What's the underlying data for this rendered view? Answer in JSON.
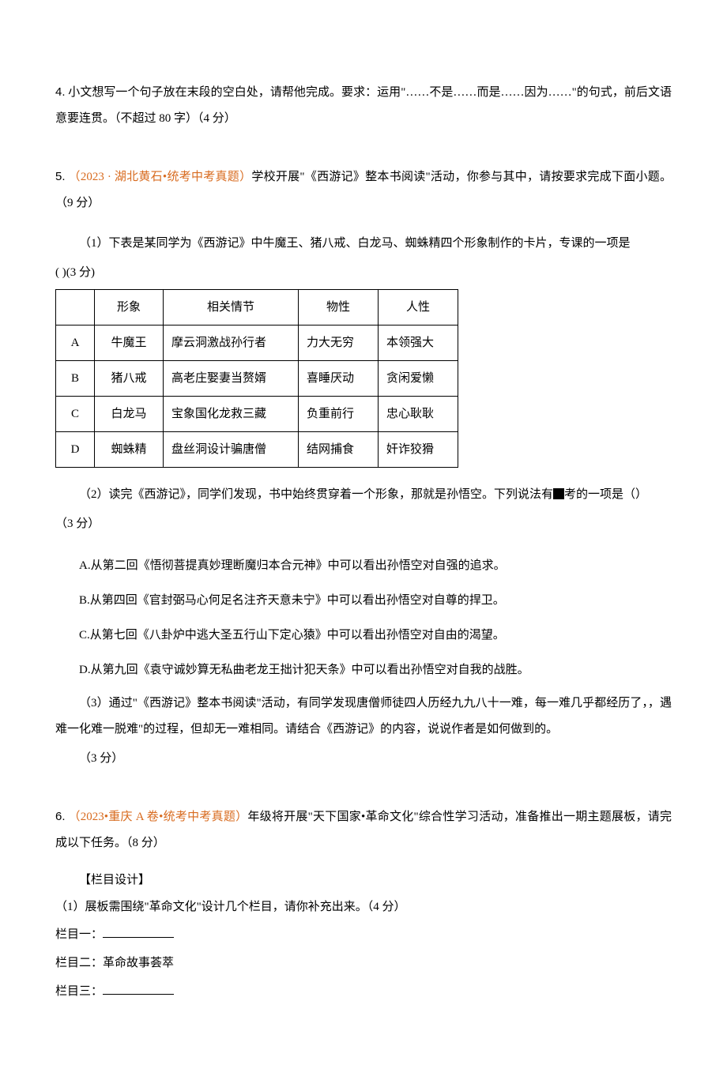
{
  "q4": {
    "number": "4.",
    "text": "  小文想写一个句子放在末段的空白处，请帮他完成。要求：运用\"……不是……而是……因为……\"的句式，前后文语意要连贯。（不超过 80 字）（4 分）"
  },
  "q5": {
    "number": "5.",
    "source": "（2023 · 湖北黄石•统考中考真题）",
    "intro": "学校开展\"《西游记》整本书阅读\"活动，你参与其中，请按要求完成下面小题。（9 分）",
    "sub1_a": "（1）下表是某同学为《西游记》中牛魔王、猪八戒、白龙马、蜘蛛精四个形象制作的卡片，专课的一项是",
    "sub1_b": "(        )(3 分)",
    "table": {
      "headers": [
        "",
        "形象",
        "相关情节",
        "物性",
        "人性"
      ],
      "rows": [
        [
          "A",
          "牛魔王",
          "摩云洞激战孙行者",
          "力大无穷",
          "本领强大"
        ],
        [
          "B",
          "猪八戒",
          "高老庄娶妻当赘婿",
          "喜睡厌动",
          "贪闲爱懒"
        ],
        [
          "C",
          "白龙马",
          "宝象国化龙救三藏",
          "负重前行",
          "忠心耿耿"
        ],
        [
          "D",
          "蜘蛛精",
          "盘丝洞设计骗唐僧",
          "结网捕食",
          "奸诈狡猾"
        ]
      ]
    },
    "sub2_a": "（2）读完《西游记》，同学们发现，书中始终贯穿着一个形象，那就是孙悟空。下列说法有",
    "sub2_b": "考的一项是（）",
    "sub2_points": "（3 分）",
    "options2": [
      "A.从第二回《悟彻菩提真妙理断魔归本合元神》中可以看出孙悟空对自强的追求。",
      "B.从第四回《官封弼马心何足名注齐天意未宁》中可以看出孙悟空对自尊的捍卫。",
      "C.从第七回《八卦炉中逃大圣五行山下定心猿》中可以看出孙悟空对自由的渴望。",
      "D.从第九回《袁守诚妙算无私曲老龙王拙计犯天条》中可以看出孙悟空对自我的战胜。"
    ],
    "sub3_a": "（3）通过\"《西游记》整本书阅读\"活动，有同学发现唐僧师徒四人历经九九八十一难，每一难几乎都经历了，，遇难一化难一脱难\"的过程，但却无一难相同。请结合《西游记》的内容，说说作者是如何做到的。",
    "sub3_points": "（3 分）"
  },
  "q6": {
    "number": "6.",
    "source": "（2023•重庆 A 卷•统考中考真题）",
    "intro": "年级将开展\"天下国家•革命文化\"综合性学习活动，准备推出一期主题展板，请完成以下任务。（8 分）",
    "heading": "【栏目设计】",
    "sub1": "（1）展板需围绕\"革命文化\"设计几个栏目，请你补充出来。（4 分）",
    "col1_label": "栏目一：",
    "col2_label": "栏目二：",
    "col2_value": "革命故事荟萃",
    "col3_label": "栏目三："
  }
}
